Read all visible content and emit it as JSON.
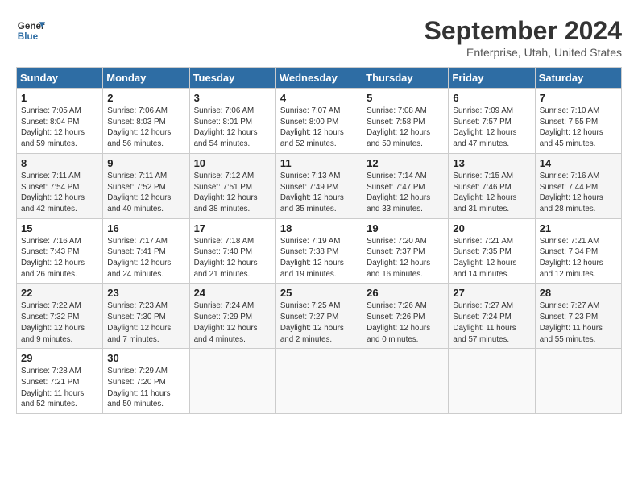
{
  "header": {
    "logo_line1": "General",
    "logo_line2": "Blue",
    "title": "September 2024",
    "location": "Enterprise, Utah, United States"
  },
  "weekdays": [
    "Sunday",
    "Monday",
    "Tuesday",
    "Wednesday",
    "Thursday",
    "Friday",
    "Saturday"
  ],
  "weeks": [
    [
      {
        "day": "1",
        "info": "Sunrise: 7:05 AM\nSunset: 8:04 PM\nDaylight: 12 hours\nand 59 minutes."
      },
      {
        "day": "2",
        "info": "Sunrise: 7:06 AM\nSunset: 8:03 PM\nDaylight: 12 hours\nand 56 minutes."
      },
      {
        "day": "3",
        "info": "Sunrise: 7:06 AM\nSunset: 8:01 PM\nDaylight: 12 hours\nand 54 minutes."
      },
      {
        "day": "4",
        "info": "Sunrise: 7:07 AM\nSunset: 8:00 PM\nDaylight: 12 hours\nand 52 minutes."
      },
      {
        "day": "5",
        "info": "Sunrise: 7:08 AM\nSunset: 7:58 PM\nDaylight: 12 hours\nand 50 minutes."
      },
      {
        "day": "6",
        "info": "Sunrise: 7:09 AM\nSunset: 7:57 PM\nDaylight: 12 hours\nand 47 minutes."
      },
      {
        "day": "7",
        "info": "Sunrise: 7:10 AM\nSunset: 7:55 PM\nDaylight: 12 hours\nand 45 minutes."
      }
    ],
    [
      {
        "day": "8",
        "info": "Sunrise: 7:11 AM\nSunset: 7:54 PM\nDaylight: 12 hours\nand 42 minutes."
      },
      {
        "day": "9",
        "info": "Sunrise: 7:11 AM\nSunset: 7:52 PM\nDaylight: 12 hours\nand 40 minutes."
      },
      {
        "day": "10",
        "info": "Sunrise: 7:12 AM\nSunset: 7:51 PM\nDaylight: 12 hours\nand 38 minutes."
      },
      {
        "day": "11",
        "info": "Sunrise: 7:13 AM\nSunset: 7:49 PM\nDaylight: 12 hours\nand 35 minutes."
      },
      {
        "day": "12",
        "info": "Sunrise: 7:14 AM\nSunset: 7:47 PM\nDaylight: 12 hours\nand 33 minutes."
      },
      {
        "day": "13",
        "info": "Sunrise: 7:15 AM\nSunset: 7:46 PM\nDaylight: 12 hours\nand 31 minutes."
      },
      {
        "day": "14",
        "info": "Sunrise: 7:16 AM\nSunset: 7:44 PM\nDaylight: 12 hours\nand 28 minutes."
      }
    ],
    [
      {
        "day": "15",
        "info": "Sunrise: 7:16 AM\nSunset: 7:43 PM\nDaylight: 12 hours\nand 26 minutes."
      },
      {
        "day": "16",
        "info": "Sunrise: 7:17 AM\nSunset: 7:41 PM\nDaylight: 12 hours\nand 24 minutes."
      },
      {
        "day": "17",
        "info": "Sunrise: 7:18 AM\nSunset: 7:40 PM\nDaylight: 12 hours\nand 21 minutes."
      },
      {
        "day": "18",
        "info": "Sunrise: 7:19 AM\nSunset: 7:38 PM\nDaylight: 12 hours\nand 19 minutes."
      },
      {
        "day": "19",
        "info": "Sunrise: 7:20 AM\nSunset: 7:37 PM\nDaylight: 12 hours\nand 16 minutes."
      },
      {
        "day": "20",
        "info": "Sunrise: 7:21 AM\nSunset: 7:35 PM\nDaylight: 12 hours\nand 14 minutes."
      },
      {
        "day": "21",
        "info": "Sunrise: 7:21 AM\nSunset: 7:34 PM\nDaylight: 12 hours\nand 12 minutes."
      }
    ],
    [
      {
        "day": "22",
        "info": "Sunrise: 7:22 AM\nSunset: 7:32 PM\nDaylight: 12 hours\nand 9 minutes."
      },
      {
        "day": "23",
        "info": "Sunrise: 7:23 AM\nSunset: 7:30 PM\nDaylight: 12 hours\nand 7 minutes."
      },
      {
        "day": "24",
        "info": "Sunrise: 7:24 AM\nSunset: 7:29 PM\nDaylight: 12 hours\nand 4 minutes."
      },
      {
        "day": "25",
        "info": "Sunrise: 7:25 AM\nSunset: 7:27 PM\nDaylight: 12 hours\nand 2 minutes."
      },
      {
        "day": "26",
        "info": "Sunrise: 7:26 AM\nSunset: 7:26 PM\nDaylight: 12 hours\nand 0 minutes."
      },
      {
        "day": "27",
        "info": "Sunrise: 7:27 AM\nSunset: 7:24 PM\nDaylight: 11 hours\nand 57 minutes."
      },
      {
        "day": "28",
        "info": "Sunrise: 7:27 AM\nSunset: 7:23 PM\nDaylight: 11 hours\nand 55 minutes."
      }
    ],
    [
      {
        "day": "29",
        "info": "Sunrise: 7:28 AM\nSunset: 7:21 PM\nDaylight: 11 hours\nand 52 minutes."
      },
      {
        "day": "30",
        "info": "Sunrise: 7:29 AM\nSunset: 7:20 PM\nDaylight: 11 hours\nand 50 minutes."
      },
      {
        "day": "",
        "info": ""
      },
      {
        "day": "",
        "info": ""
      },
      {
        "day": "",
        "info": ""
      },
      {
        "day": "",
        "info": ""
      },
      {
        "day": "",
        "info": ""
      }
    ]
  ]
}
